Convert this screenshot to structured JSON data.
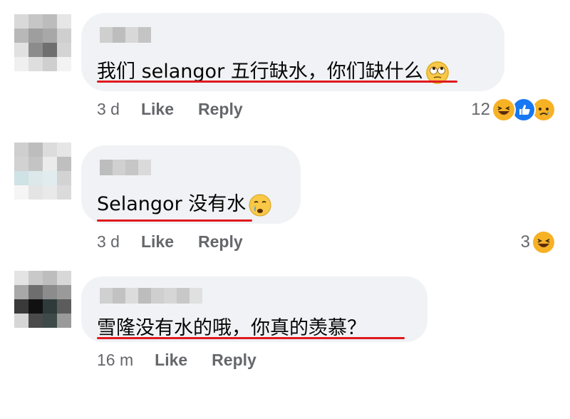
{
  "comments": [
    {
      "text": "我们 selangor 五行缺水，你们缺什么",
      "emoji": "eye-roll-emoji",
      "time": "3 d",
      "like_label": "Like",
      "reply_label": "Reply",
      "reaction_count": "12",
      "reactions": [
        "haha-reaction-icon",
        "like-reaction-icon",
        "sad-reaction-icon"
      ]
    },
    {
      "text": "Selangor 没有水",
      "emoji": "crying-emoji",
      "time": "3 d",
      "like_label": "Like",
      "reply_label": "Reply",
      "reaction_count": "3",
      "reactions": [
        "haha-reaction-icon"
      ]
    },
    {
      "text": "雪隆没有水的哦，你真的羡慕？",
      "time": "16 m",
      "like_label": "Like",
      "reply_label": "Reply"
    }
  ],
  "colors": {
    "bubble": "#f0f2f5",
    "meta_text": "#65676b",
    "underline": "#e0191e",
    "like_blue": "#1877f2",
    "emoji_yellow": "#f7b125"
  }
}
